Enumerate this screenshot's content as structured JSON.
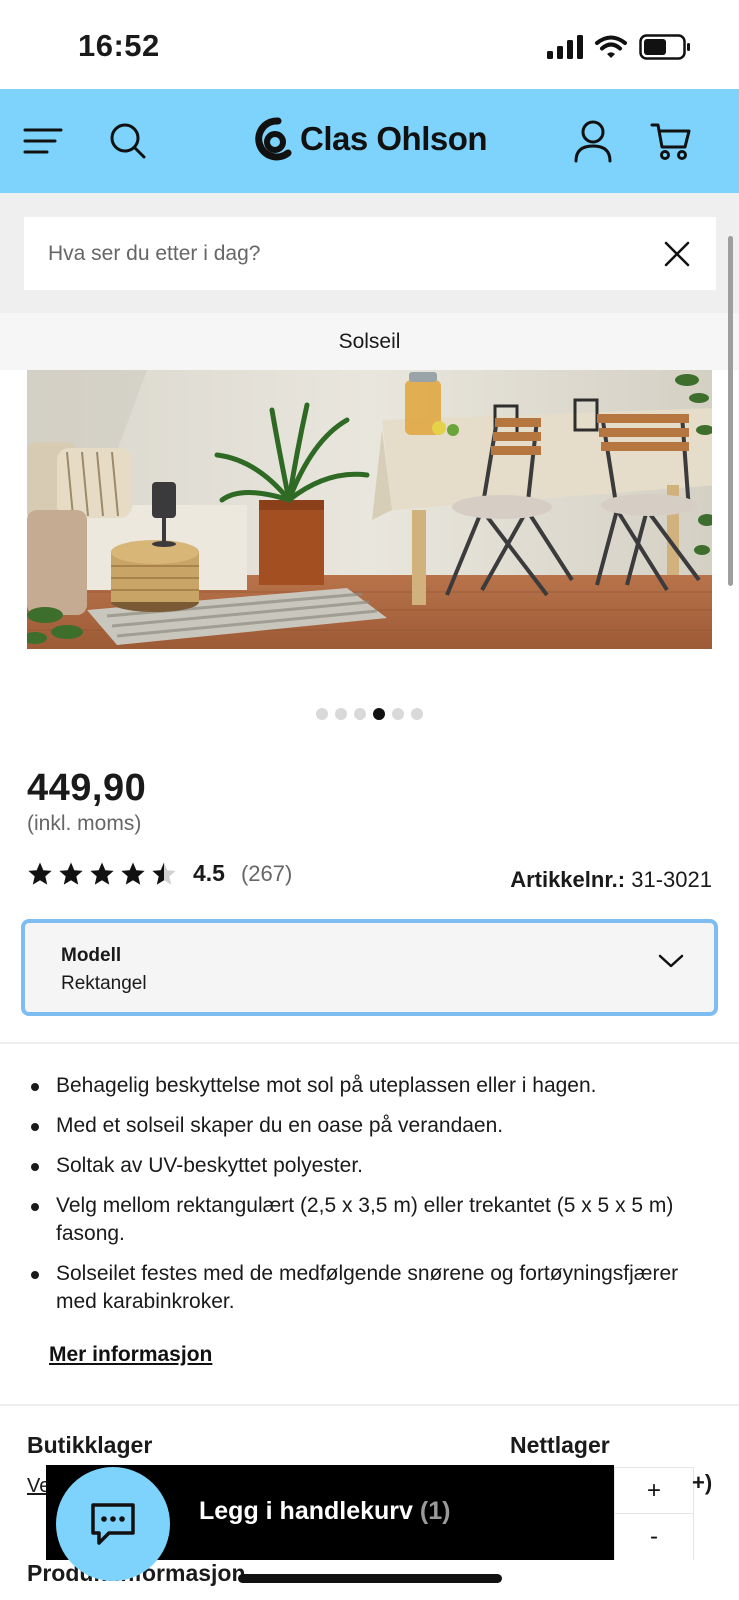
{
  "status_bar": {
    "time": "16:52"
  },
  "brand": {
    "name": "Clas Ohlson",
    "header_color": "#7dd3fb",
    "accent_border": "#7dbdf2"
  },
  "search": {
    "placeholder": "Hva ser du etter i dag?"
  },
  "breadcrumb": {
    "current": "Solseil"
  },
  "gallery": {
    "total_images": 6,
    "active_index": 3
  },
  "product": {
    "price": "449,90",
    "vat_note": "(inkl. moms)",
    "rating": {
      "score": "4.5",
      "count": "(267)",
      "stars_value": 4.5,
      "stars_max": 5
    },
    "article_label": "Artikkelnr.:",
    "article_number": "31-3021",
    "model": {
      "label": "Modell",
      "value": "Rektangel"
    },
    "features": [
      "Behagelig beskyttelse mot sol på uteplassen eller i hagen.",
      "Med et solseil skaper du en oase på verandaen.",
      "Soltak av UV-beskyttet polyester.",
      "Velg mellom rektangulært (2,5 x 3,5 m) eller trekantet (5 x 5 x 5 m) fasong.",
      "Solseilet festes med de medfølgende snørene og fortøyningsfjærer med karabinkroker."
    ],
    "more_info_link": "Mer informasjon"
  },
  "stock": {
    "store_title": "Butikklager",
    "store_link_partial": "Ve",
    "online_title": "Nettlager",
    "online_peek": "+)"
  },
  "section_peek": {
    "product_info": "Produktinformasjon"
  },
  "cart": {
    "label": "Legg i handlekurv",
    "count": "(1)",
    "plus": "+",
    "minus": "-"
  },
  "icons": {
    "menu": "hamburger-menu-icon",
    "search": "search-icon",
    "account": "user-icon",
    "cart": "cart-icon",
    "clear": "close-icon",
    "select": "chevron-down-icon",
    "chat": "chat-bubble-icon"
  }
}
